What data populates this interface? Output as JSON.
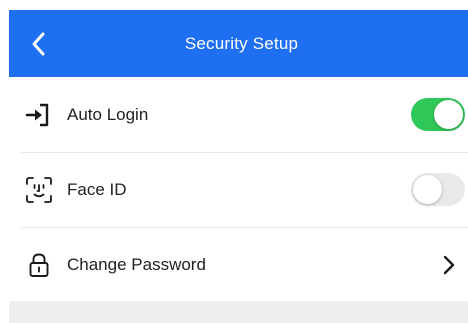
{
  "header": {
    "title": "Security Setup",
    "back_icon": "chevron-left-icon"
  },
  "rows": [
    {
      "label": "Auto Login",
      "icon": "login-arrow-icon",
      "control": "toggle",
      "enabled": true
    },
    {
      "label": "Face ID",
      "icon": "face-id-icon",
      "control": "toggle",
      "enabled": false
    },
    {
      "label": "Change Password",
      "icon": "lock-icon",
      "control": "chevron",
      "chevron_icon": "chevron-right-icon"
    }
  ],
  "colors": {
    "header_bg": "#1f6ff2",
    "toggle_on": "#30c759",
    "toggle_off": "#e9e9ea"
  }
}
